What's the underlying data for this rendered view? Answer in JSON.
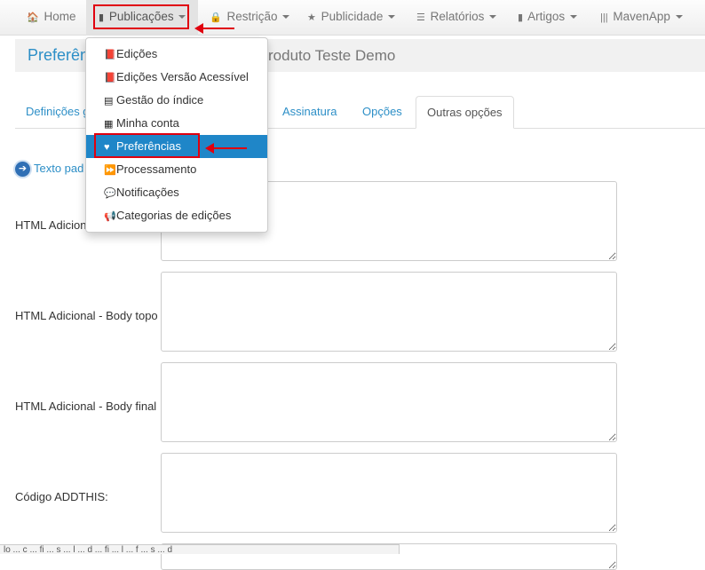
{
  "navbar": {
    "items": [
      {
        "icon": "home-icon",
        "glyph": "🏠",
        "label": "Home"
      },
      {
        "icon": "file-icon",
        "glyph": "▮",
        "label": "Publicações"
      },
      {
        "icon": "lock-icon",
        "glyph": "🔒",
        "label": "Restrição"
      },
      {
        "icon": "star-icon",
        "glyph": "★",
        "label": "Publicidade"
      },
      {
        "icon": "list-icon",
        "glyph": "☰",
        "label": "Relatórios"
      },
      {
        "icon": "bookmark-icon",
        "glyph": "▮",
        "label": "Artigos"
      },
      {
        "icon": "barcode-icon",
        "glyph": "|||",
        "label": "MavenApp"
      }
    ]
  },
  "page": {
    "title_left": "Preferên",
    "title_right": "roduto Teste Demo"
  },
  "tabs": [
    {
      "label": "Definições g"
    },
    {
      "label": "Assinatura"
    },
    {
      "label": "Opções"
    },
    {
      "label": "Outras opções"
    }
  ],
  "link_text": "Texto pad",
  "fields": [
    {
      "label": "HTML Adicion"
    },
    {
      "label": "HTML Adicional - Body topo"
    },
    {
      "label": "HTML Adicional - Body final"
    },
    {
      "label": "Código ADDTHIS:"
    }
  ],
  "dropdown": {
    "items": [
      {
        "icon": "book-icon",
        "glyph": "📕",
        "label": "Edições"
      },
      {
        "icon": "book-icon",
        "glyph": "📕",
        "label": "Edições Versão Acessível"
      },
      {
        "icon": "list-alt-icon",
        "glyph": "▤",
        "label": "Gestão do índice"
      },
      {
        "icon": "th-icon",
        "glyph": "▦",
        "label": "Minha conta"
      },
      {
        "icon": "heart-icon",
        "glyph": "♥",
        "label": "Preferências"
      },
      {
        "icon": "forward-icon",
        "glyph": "⏩",
        "label": "Processamento"
      },
      {
        "icon": "comment-icon",
        "glyph": "💬",
        "label": "Notificações"
      },
      {
        "icon": "bullhorn-icon",
        "glyph": "📢",
        "label": "Categorias de edições"
      }
    ]
  },
  "statusbar": {
    "text": "lo ... c ... fi ... s ... l ... d ... fi ... l ... f ... s ... d"
  },
  "colors": {
    "accent": "#2d8fc7",
    "highlight": "#e0000f",
    "menu_active": "#1f86c8"
  }
}
